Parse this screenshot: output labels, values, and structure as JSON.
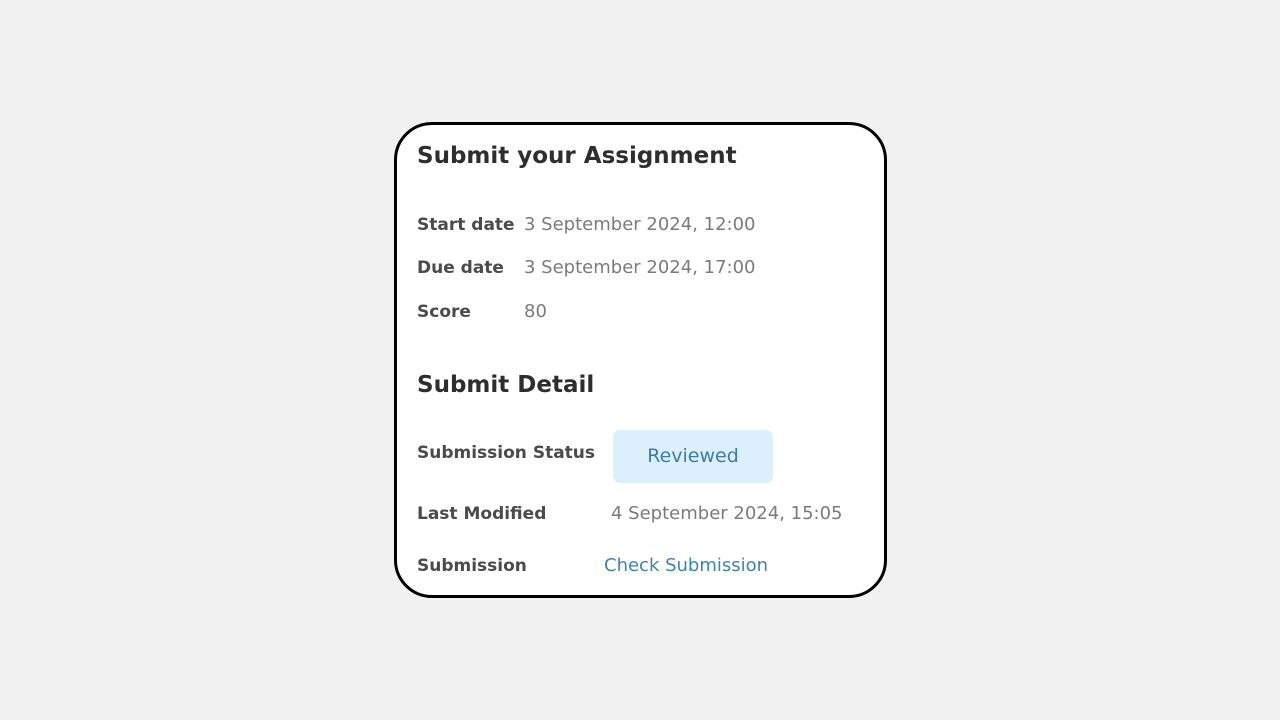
{
  "assignment": {
    "title": "Submit your Assignment",
    "start_date": {
      "label": "Start date",
      "value": "3 September 2024, 12:00"
    },
    "due_date": {
      "label": "Due date",
      "value": "3 September 2024, 17:00"
    },
    "score": {
      "label": "Score",
      "value": "80"
    }
  },
  "submit_detail": {
    "title": "Submit Detail",
    "status": {
      "label": "Submission Status",
      "value": "Reviewed"
    },
    "last_modified": {
      "label": "Last Modified",
      "value": "4 September 2024, 15:05"
    },
    "submission": {
      "label": "Submission",
      "link_text": "Check Submission"
    }
  },
  "colors": {
    "page_background": "#f1f1f1",
    "card_border": "#000000",
    "badge_background": "#dbeffc",
    "badge_text": "#3d7ca6",
    "link": "#3d84b5"
  }
}
